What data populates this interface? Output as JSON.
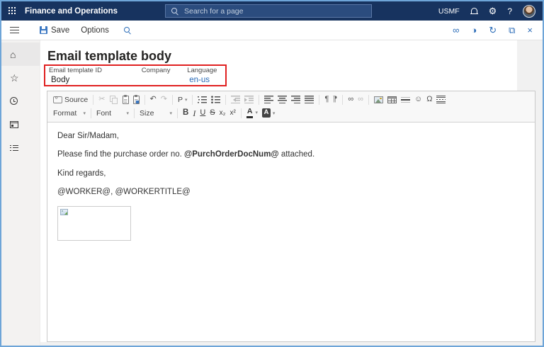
{
  "colors": {
    "accent": "#2b6cb8",
    "topbar_bg": "#17335f",
    "annotation_red": "#e02020",
    "window_frame": "#6ea5d8",
    "link": "#2b6cb8"
  },
  "topbar": {
    "app_title": "Finance and Operations",
    "search_placeholder": "Search for a page",
    "company": "USMF",
    "gear_glyph": "⚙",
    "help_label": "?"
  },
  "actionbar": {
    "save_label": "Save",
    "options_label": "Options",
    "right_icons": [
      {
        "name": "attachments-icon",
        "glyph": "∞"
      },
      {
        "name": "contrast-icon",
        "glyph": "◑"
      },
      {
        "name": "refresh-icon",
        "glyph": "↻"
      },
      {
        "name": "open-new-window-icon",
        "glyph": "⧉"
      },
      {
        "name": "close-icon",
        "glyph": "×"
      }
    ]
  },
  "sidebar": {
    "items": [
      {
        "id": "home",
        "icon": "home-icon",
        "glyph": "⌂",
        "active": true
      },
      {
        "id": "favorites",
        "icon": "star-icon",
        "glyph": "☆"
      },
      {
        "id": "recent",
        "icon": "clock-icon",
        "css": "i-clock"
      },
      {
        "id": "workspaces",
        "icon": "workspaces-icon",
        "css": "i-window"
      },
      {
        "id": "modules",
        "icon": "modules-icon",
        "css": "i-modules"
      }
    ]
  },
  "page": {
    "title": "Email template body"
  },
  "fields": {
    "items": [
      {
        "label": "Email template ID",
        "value": "Body"
      },
      {
        "label": "Company",
        "value": ""
      },
      {
        "label": "Language",
        "value": "en-us"
      }
    ]
  },
  "editor": {
    "toolbar": {
      "rows": [
        [
          [
            {
              "name": "source-button",
              "icon": "source-icon",
              "css": "tbi tbi-source",
              "label": "Source"
            }
          ],
          [
            {
              "name": "cut-button",
              "icon": "cut-icon",
              "glyph": "✂",
              "disabled": true
            },
            {
              "name": "copy-button",
              "icon": "copy-icon",
              "css": "tbi tbi-copy",
              "disabled": true
            },
            {
              "name": "paste-button",
              "icon": "paste-icon",
              "css": "tbi tbi-paste"
            },
            {
              "name": "paste-from-word-button",
              "icon": "paste-from-word-icon",
              "css": "tbi tbi-paste tbi-pasteword"
            }
          ],
          [
            {
              "name": "undo-button",
              "icon": "undo-icon",
              "glyph": "↶"
            },
            {
              "name": "redo-button",
              "icon": "redo-icon",
              "glyph": "↷",
              "disabled": true
            }
          ],
          [
            {
              "name": "paragraph-format-dropdown",
              "label": "P",
              "caret": true
            }
          ],
          [
            {
              "name": "numbered-list-button",
              "icon": "numbered-list-icon",
              "css": "tbi tbi-ol"
            },
            {
              "name": "bulleted-list-button",
              "icon": "bulleted-list-icon",
              "css": "tbi tbi-ul"
            }
          ],
          [
            {
              "name": "decrease-indent-button",
              "icon": "decrease-indent-icon",
              "css": "tbi tbi-outdent",
              "disabled": true
            },
            {
              "name": "increase-indent-button",
              "icon": "increase-indent-icon",
              "css": "tbi tbi-indent",
              "disabled": true
            }
          ],
          [
            {
              "name": "align-left-button",
              "icon": "align-left-icon",
              "css": "tbi tbi-al"
            },
            {
              "name": "align-center-button",
              "icon": "align-center-icon",
              "css": "tbi tbi-ac"
            },
            {
              "name": "align-right-button",
              "icon": "align-right-icon",
              "css": "tbi tbi-ar"
            },
            {
              "name": "align-justify-button",
              "icon": "align-justify-icon",
              "css": "tbi tbi-aj"
            }
          ],
          [
            {
              "name": "ltr-paragraph-button",
              "icon": "ltr-paragraph-icon",
              "glyph": "¶"
            },
            {
              "name": "rtl-paragraph-button",
              "icon": "rtl-paragraph-icon",
              "glyph": "¶",
              "cls": "flip"
            }
          ],
          [
            {
              "name": "link-button",
              "icon": "link-icon",
              "glyph": "∞"
            },
            {
              "name": "unlink-button",
              "icon": "unlink-icon",
              "glyph": "∞",
              "disabled": true
            }
          ],
          [
            {
              "name": "insert-image-button",
              "icon": "insert-image-icon",
              "css": "tbi tbi-img"
            },
            {
              "name": "insert-table-button",
              "icon": "insert-table-icon",
              "css": "tbi tbi-table"
            },
            {
              "name": "horizontal-rule-button",
              "icon": "horizontal-rule-icon",
              "css": "tbi tbi-hr"
            },
            {
              "name": "smiley-button",
              "icon": "smiley-icon",
              "glyph": "☺"
            },
            {
              "name": "special-character-button",
              "icon": "special-character-icon",
              "glyph": "Ω"
            },
            {
              "name": "page-break-button",
              "icon": "page-break-icon",
              "css": "tbi tbi-pagebreak"
            }
          ]
        ],
        [
          [
            {
              "name": "format-dropdown",
              "label": "Format",
              "caret": true,
              "combo": true
            }
          ],
          [
            {
              "name": "font-dropdown",
              "label": "Font",
              "caret": true,
              "combo": true
            }
          ],
          [
            {
              "name": "size-dropdown",
              "label": "Size",
              "caret": true,
              "combo": true
            }
          ],
          [
            {
              "name": "bold-button",
              "icon": "bold-icon",
              "glyph": "B",
              "cls": "g-b"
            },
            {
              "name": "italic-button",
              "icon": "italic-icon",
              "glyph": "I",
              "cls": "g-i"
            },
            {
              "name": "underline-button",
              "icon": "underline-icon",
              "glyph": "U",
              "cls": "g-u"
            },
            {
              "name": "strikethrough-button",
              "icon": "strikethrough-icon",
              "glyph": "S",
              "cls": "g-s"
            },
            {
              "name": "subscript-button",
              "icon": "subscript-icon",
              "glyph": "x₂",
              "cls": "g-sm"
            },
            {
              "name": "superscript-button",
              "icon": "superscript-icon",
              "glyph": "x²",
              "cls": "g-sm"
            }
          ],
          [
            {
              "name": "text-color-dropdown",
              "icon": "text-color-icon",
              "glyph": "A",
              "css": "tbi-txtcolor",
              "caret": true
            },
            {
              "name": "background-color-dropdown",
              "icon": "background-color-icon",
              "glyph": "A",
              "css": "tbi-bgcolor",
              "caret": true
            }
          ]
        ]
      ]
    },
    "body": {
      "paragraphs": [
        [
          {
            "text": "Dear Sir/Madam,"
          }
        ],
        [
          {
            "text": "Please find the purchase order no. "
          },
          {
            "text": "@PurchOrderDocNum@",
            "bold": true
          },
          {
            "text": " attached."
          }
        ],
        [
          {
            "text": "Kind regards,"
          }
        ],
        [
          {
            "text": "@WORKER@, @WORKERTITLE@"
          }
        ]
      ]
    }
  }
}
